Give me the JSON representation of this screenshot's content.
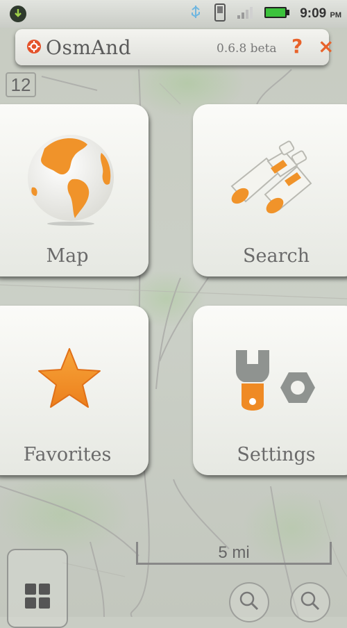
{
  "status_bar": {
    "time": "9:09",
    "ampm": "PM",
    "icons": [
      "download-icon",
      "usb-icon",
      "phone-icon",
      "signal-icon",
      "battery-icon"
    ]
  },
  "title_bar": {
    "app_name": "OsmAnd",
    "version": "0.6.8 beta",
    "help_label": "?",
    "close_label": "×"
  },
  "map": {
    "zoom_level": "12",
    "scale_label": "5 mi"
  },
  "menu": {
    "map_label": "Map",
    "search_label": "Search",
    "favorites_label": "Favorites",
    "settings_label": "Settings"
  },
  "colors": {
    "accent": "#f0932a",
    "accent_dark": "#e8622a",
    "gray_icon": "#8f9390"
  }
}
